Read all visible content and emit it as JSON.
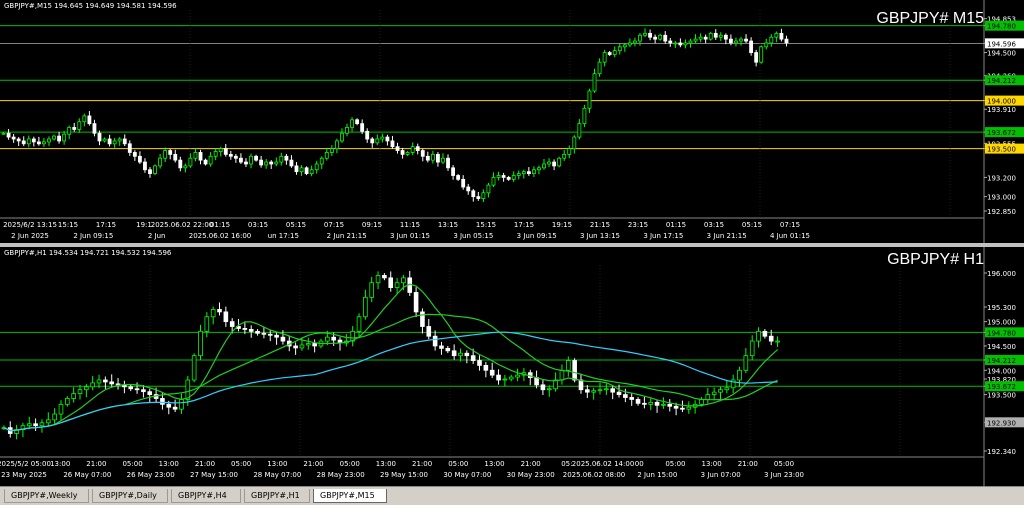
{
  "colors": {
    "bg": "#000000",
    "bull": "#00ff00",
    "bear": "#ffffff",
    "grid": "#4a4a4a",
    "green_line": "#00c000",
    "yellow_line": "#ffd700",
    "ma_cyan": "#33ccff",
    "ma_green": "#22cc22"
  },
  "m15": {
    "header": "GBPJPY#,M15  194.645 194.649 194.581 194.596",
    "symbol": "GBPJPY# M15",
    "prices": [
      {
        "text": "194.853",
        "kind": "plain"
      },
      {
        "text": "194.780",
        "kind": "green"
      },
      {
        "text": "194.596",
        "kind": "white"
      },
      {
        "text": "194.500",
        "kind": "plain"
      },
      {
        "text": "194.260",
        "kind": "plain"
      },
      {
        "text": "194.212",
        "kind": "green"
      },
      {
        "text": "193.910",
        "kind": "plain"
      },
      {
        "text": "194.000",
        "kind": "yellow"
      },
      {
        "text": "193.672",
        "kind": "green"
      },
      {
        "text": "193.555",
        "kind": "plain"
      },
      {
        "text": "193.500",
        "kind": "yellow"
      },
      {
        "text": "193.200",
        "kind": "plain"
      },
      {
        "text": "193.000",
        "kind": "plain"
      },
      {
        "text": "192.850",
        "kind": "plain"
      }
    ],
    "time_row1": [
      "2025/6/2 13:15",
      "15:15",
      "17:15",
      "19:1",
      "2025.06.02 22:00",
      "01:15",
      "03:15",
      "05:15",
      "07:15",
      "09:15",
      "11:15",
      "13:15",
      "15:15",
      "17:15",
      "19:15",
      "21:15",
      "23:15",
      "01:15",
      "03:15",
      "05:15",
      "07:15"
    ],
    "time_row2": [
      "2 Jun 2025",
      "2 Jun 09:15",
      "2 Jun",
      "2025.06.02 16:00",
      "un 17:15",
      "2 Jun 21:15",
      "3 Jun 01:15",
      "3 Jun 05:15",
      "3 Jun 09:15",
      "3 Jun 13:15",
      "3 Jun 17:15",
      "3 Jun 21:15",
      "4 Jun 01:15"
    ],
    "closes": [
      193.66,
      193.62,
      193.6,
      193.58,
      193.55,
      193.6,
      193.57,
      193.55,
      193.57,
      193.6,
      193.63,
      193.58,
      193.65,
      193.72,
      193.7,
      193.78,
      193.84,
      193.76,
      193.66,
      193.58,
      193.6,
      193.55,
      193.58,
      193.6,
      193.55,
      193.46,
      193.42,
      193.36,
      193.28,
      193.24,
      193.32,
      193.4,
      193.48,
      193.44,
      193.38,
      193.3,
      193.32,
      193.4,
      193.46,
      193.38,
      193.34,
      193.42,
      193.47,
      193.5,
      193.44,
      193.42,
      193.4,
      193.36,
      193.34,
      193.42,
      193.38,
      193.33,
      193.36,
      193.34,
      193.36,
      193.42,
      193.38,
      193.32,
      193.26,
      193.3,
      193.24,
      193.28,
      193.34,
      193.4,
      193.46,
      193.5,
      193.58,
      193.66,
      193.72,
      193.8,
      193.76,
      193.68,
      193.6,
      193.56,
      193.6,
      193.62,
      193.58,
      193.52,
      193.48,
      193.44,
      193.46,
      193.52,
      193.48,
      193.42,
      193.38,
      193.44,
      193.36,
      193.4,
      193.3,
      193.22,
      193.18,
      193.1,
      193.06,
      193.0,
      192.98,
      193.04,
      193.12,
      193.2,
      193.22,
      193.2,
      193.18,
      193.22,
      193.24,
      193.26,
      193.24,
      193.28,
      193.3,
      193.34,
      193.36,
      193.32,
      193.4,
      193.44,
      193.5,
      193.62,
      193.76,
      193.92,
      194.1,
      194.28,
      194.4,
      194.5,
      194.48,
      194.52,
      194.56,
      194.58,
      194.6,
      194.62,
      194.68,
      194.7,
      194.66,
      194.64,
      194.68,
      194.62,
      194.6,
      194.6,
      194.58,
      194.6,
      194.62,
      194.64,
      194.66,
      194.64,
      194.7,
      194.66,
      194.68,
      194.64,
      194.6,
      194.62,
      194.64,
      194.62,
      194.5,
      194.4,
      194.56,
      194.6,
      194.66,
      194.7,
      194.64,
      194.6
    ]
  },
  "h1": {
    "header": "GBPJPY#,H1  194.534 194.721 194.532 194.596",
    "symbol": "GBPJPY# H1",
    "prices": [
      {
        "text": "196.000",
        "kind": "plain"
      },
      {
        "text": "195.300",
        "kind": "plain"
      },
      {
        "text": "195.000",
        "kind": "plain"
      },
      {
        "text": "194.780",
        "kind": "green"
      },
      {
        "text": "194.500",
        "kind": "plain"
      },
      {
        "text": "194.212",
        "kind": "green"
      },
      {
        "text": "194.000",
        "kind": "plain"
      },
      {
        "text": "193.820",
        "kind": "plain"
      },
      {
        "text": "193.672",
        "kind": "green"
      },
      {
        "text": "193.500",
        "kind": "plain"
      },
      {
        "text": "192.930",
        "kind": "gray"
      },
      {
        "text": "192.340",
        "kind": "plain"
      }
    ],
    "time_row1": [
      "2025/5/2 05:00",
      "13:00",
      "21:00",
      "05:00",
      "13:00",
      "21:00",
      "05:00",
      "13:00",
      "21:00",
      "05:00",
      "13:00",
      "21:00",
      "05:00",
      "13:00",
      "21:00",
      "05:",
      "2025.06.02 14:00",
      "00",
      "05:00",
      "13:00",
      "21:00",
      "05:00"
    ],
    "time_row2": [
      "23 May 2025",
      "26 May 07:00",
      "26 May 23:00",
      "27 May 15:00",
      "28 May 07:00",
      "28 May 23:00",
      "29 May 15:00",
      "30 May 07:00",
      "30 May 23:00",
      "2025.06.02 08:00",
      "2 Jun 15:00",
      "3 Jun 07:00",
      "3 Jun 23:00"
    ],
    "closes": [
      192.82,
      192.7,
      192.78,
      192.86,
      192.9,
      192.86,
      192.92,
      192.98,
      193.1,
      193.3,
      193.42,
      193.52,
      193.6,
      193.66,
      193.74,
      193.8,
      193.76,
      193.72,
      193.7,
      193.66,
      193.62,
      193.6,
      193.56,
      193.5,
      193.42,
      193.3,
      193.24,
      193.2,
      193.4,
      193.8,
      194.3,
      194.8,
      195.1,
      195.25,
      195.2,
      195.0,
      194.9,
      194.86,
      194.84,
      194.8,
      194.76,
      194.74,
      194.72,
      194.68,
      194.6,
      194.5,
      194.46,
      194.52,
      194.55,
      194.5,
      194.6,
      194.68,
      194.62,
      194.56,
      194.6,
      194.8,
      195.1,
      195.5,
      195.8,
      195.95,
      195.9,
      195.7,
      195.8,
      195.9,
      195.6,
      195.2,
      194.9,
      194.7,
      194.5,
      194.45,
      194.4,
      194.3,
      194.35,
      194.3,
      194.2,
      194.1,
      194.0,
      193.9,
      193.8,
      193.82,
      193.86,
      193.9,
      193.95,
      193.85,
      193.7,
      193.6,
      193.62,
      193.8,
      194.0,
      194.2,
      193.8,
      193.6,
      193.55,
      193.58,
      193.6,
      193.62,
      193.55,
      193.5,
      193.44,
      193.4,
      193.32,
      193.3,
      193.34,
      193.28,
      193.3,
      193.26,
      193.22,
      193.2,
      193.24,
      193.3,
      193.4,
      193.5,
      193.55,
      193.6,
      193.64,
      193.8,
      194.0,
      194.3,
      194.6,
      194.8,
      194.7,
      194.6,
      194.6
    ]
  },
  "tabs": [
    {
      "label": "GBPJPY#,Weekly",
      "active": false
    },
    {
      "label": "GBPJPY#,Daily",
      "active": false
    },
    {
      "label": "GBPJPY#,H4",
      "active": false
    },
    {
      "label": "GBPJPY#,H1",
      "active": false
    },
    {
      "label": "GBPJPY#,M15",
      "active": true
    }
  ]
}
